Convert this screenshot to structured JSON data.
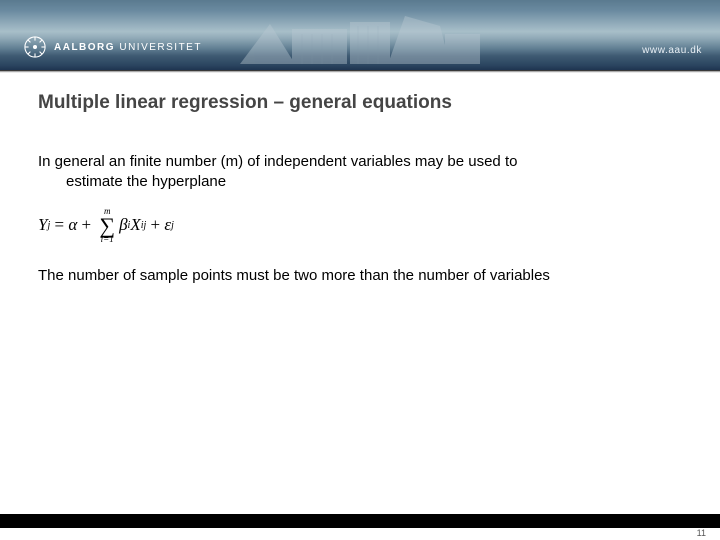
{
  "header": {
    "logo_main": "AALBORG",
    "logo_sub": "UNIVERSITET",
    "url": "www.aau.dk"
  },
  "title": "Multiple linear regression – general equations",
  "body": {
    "para1_line1": "In general an finite number (m) of independent variables may be used to",
    "para1_line2": "estimate the hyperplane",
    "para2": "The number of sample points must be two more than the number of variables"
  },
  "formula": {
    "Y": "Y",
    "Y_sub": "j",
    "eq": "=",
    "alpha": "α",
    "plus1": "+",
    "sum_top": "m",
    "sum_sym": "∑",
    "sum_bot": "i=1",
    "beta": "β",
    "beta_sub": "i",
    "X": "X",
    "X_sub": "ij",
    "plus2": "+",
    "eps": "ε",
    "eps_sub": "j"
  },
  "page_number": "11"
}
